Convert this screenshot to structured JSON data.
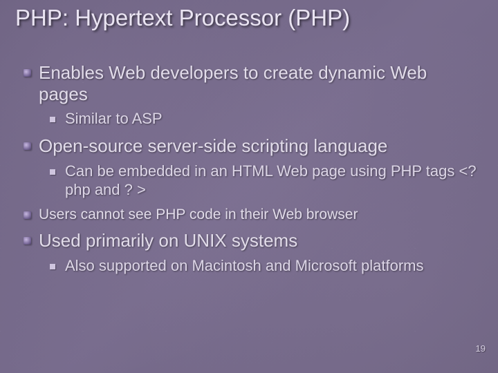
{
  "title": "PHP: Hypertext Processor (PHP)",
  "bullets": {
    "b1": "Enables Web developers to create dynamic Web pages",
    "b1_1": "Similar to ASP",
    "b2": "Open-source server-side scripting language",
    "b2_1": "Can be embedded in an HTML Web page using PHP tags <? php and ? >",
    "b3": "Users cannot see PHP code in their Web browser",
    "b4": "Used primarily on UNIX systems",
    "b4_1": "Also supported on Macintosh and Microsoft platforms"
  },
  "page_number": "19"
}
